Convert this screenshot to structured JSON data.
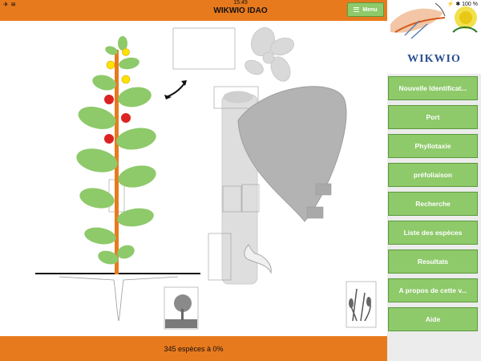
{
  "status": {
    "left": "✈ ≋",
    "time": "15:49",
    "right": "⚡ ✱ 100 %"
  },
  "header": {
    "title": "WIKWIO IDAO",
    "menu_label": "Menu"
  },
  "brand": "WIKWIO",
  "sidebar": {
    "items": [
      {
        "label": "Nouvelle Identificat..."
      },
      {
        "label": "Port"
      },
      {
        "label": "Phyllotaxie"
      },
      {
        "label": "préfoliaison"
      },
      {
        "label": "Recherche"
      },
      {
        "label": "Liste des espèces"
      },
      {
        "label": "Resultats"
      },
      {
        "label": "A propos de cette v..."
      },
      {
        "label": "Aide"
      }
    ]
  },
  "footer": {
    "text": "345 espèces à 0%"
  },
  "colors": {
    "accent": "#e87a1e",
    "button": "#8ec96a",
    "leaf": "#8ec96a",
    "stem": "#e87a1e",
    "fruit": "#dd2222",
    "flower": "#ffe100"
  }
}
